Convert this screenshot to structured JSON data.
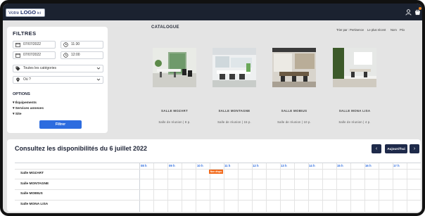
{
  "header": {
    "logo_prefix": "Votre ",
    "logo_bold": "LOGO",
    "logo_suffix": " ici",
    "icons": [
      "user-icon",
      "cart-icon"
    ],
    "accent": "#f08a24"
  },
  "filters": {
    "title": "FILTRES",
    "start_date": "07/07/2022",
    "start_time": "11:30",
    "end_date": "07/07/2022",
    "end_time": "12:00",
    "category_select": "Toutes les catégories",
    "location_select": "Où ?",
    "options_title": "OPTIONS",
    "options": [
      "▾ Équipements",
      "▾ Services annexes",
      "▾ Site"
    ],
    "submit_label": "Filtrer"
  },
  "catalogue": {
    "title": "CATALOGUE",
    "sort_label": "Trier par :",
    "sort_options": [
      "Pertinence",
      "Le plus récent",
      "Nom",
      "Prix"
    ],
    "rooms": [
      {
        "name": "SALLE MOZART",
        "desc": "Salle de réunion | 8 p."
      },
      {
        "name": "SALLE MONTAGNE",
        "desc": "Salle de réunion | 15 p."
      },
      {
        "name": "SALLE MOBIUS",
        "desc": "Salle de réunion | 10 p."
      },
      {
        "name": "SALLE MONA LISA",
        "desc": "Salle de réunion | 4 p."
      }
    ]
  },
  "availability": {
    "title": "Consultez les disponibilités du 6 juillet 2022",
    "prev_label": "‹",
    "today_label": "Aujourd'hui",
    "next_label": "›",
    "hours": [
      "08 h",
      "09 h",
      "10 h",
      "11 h",
      "12 h",
      "13 h",
      "14 h",
      "15 h",
      "16 h",
      "17 h"
    ],
    "rooms": [
      "Salle MOZART",
      "Salle MONTAGNE",
      "Salle MOBIUS",
      "Salle MONA LISA"
    ],
    "booking_label": "Non dispo",
    "booking_color": "#f26a1b"
  }
}
